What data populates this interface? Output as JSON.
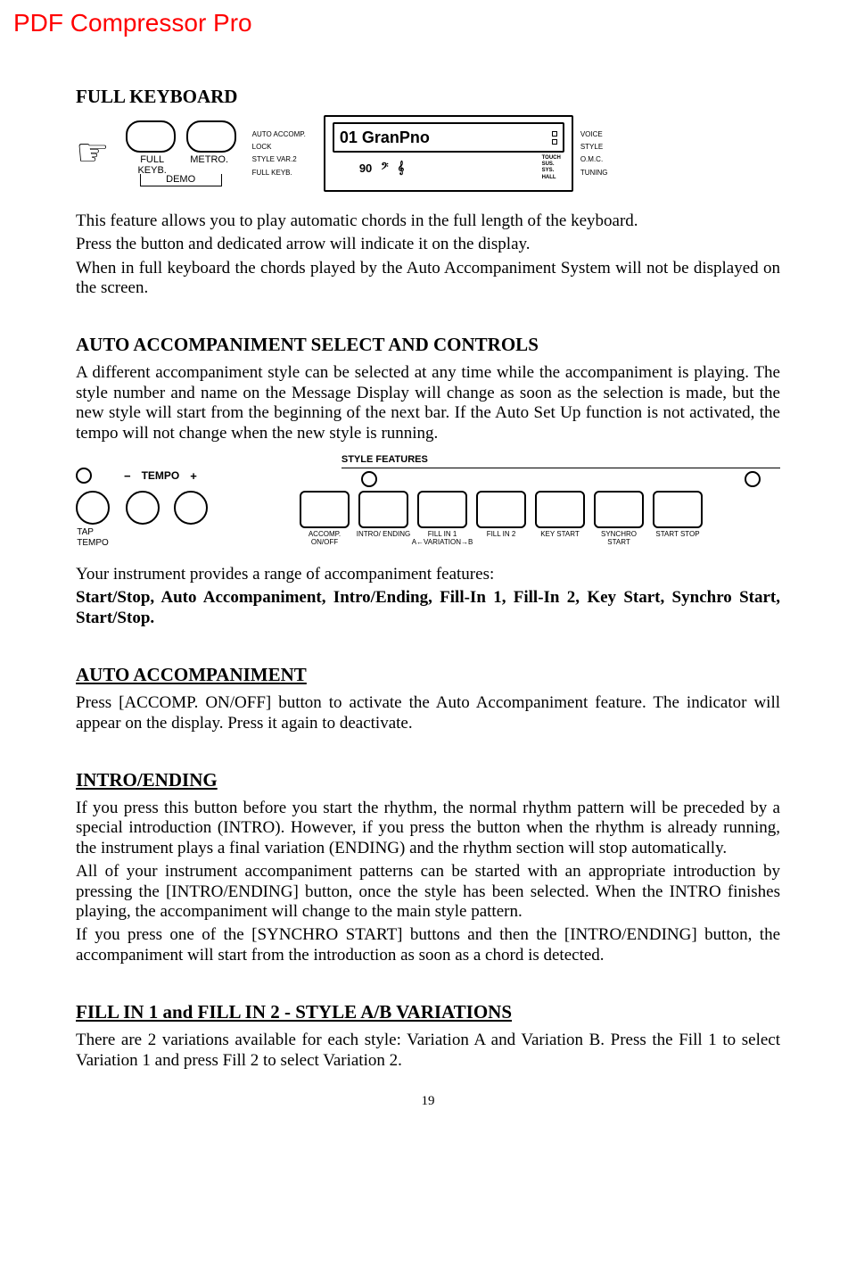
{
  "watermark": "PDF Compressor Pro",
  "page_number": "19",
  "fig1": {
    "btn1": "FULL KEYB.",
    "btn2": "METRO.",
    "demo": "DEMO",
    "left_labels": [
      "AUTO ACCOMP.",
      "LOCK",
      "STYLE VAR.2",
      "FULL KEYB."
    ],
    "lcd_title": "01 GranPno",
    "lcd_tempo": "90",
    "tiny": [
      "TOUCH",
      "SUS.",
      "SYS.",
      "HALL"
    ],
    "right_labels": [
      "VOICE",
      "STYLE",
      "O.M.C.",
      "TUNING"
    ]
  },
  "fig2": {
    "tempo_minus": "−",
    "tempo_hdr": "TEMPO",
    "tempo_plus": "+",
    "sf_hdr": "STYLE FEATURES",
    "tap_label": "TAP\nTEMPO",
    "cols": [
      "ACCOMP. ON/OFF",
      "INTRO/ ENDING",
      "FILL IN 1 A←VARIATION→B",
      "FILL IN 2",
      "KEY START",
      "SYNCHRO START",
      "START STOP"
    ]
  },
  "sections": {
    "s1_title": "FULL KEYBOARD",
    "s1_p1": "This feature allows you to play automatic chords in the full length of the keyboard.",
    "s1_p2": "Press the button and dedicated arrow will indicate it on the display.",
    "s1_p3": "When in full keyboard the chords played by the Auto Accompaniment System will not be displayed on the screen.",
    "s2_title": "AUTO ACCOMPANIMENT SELECT AND CONTROLS",
    "s2_p1": "A different accompaniment style can be selected at any time while the accompaniment is playing. The style number and name on the Message Display will change as soon as the selection is made, but the new style will start from the beginning of the next bar. If the Auto Set Up function is not activated, the tempo will not change when the new style is running.",
    "s2_intro": "Your instrument provides a range of accompaniment features:",
    "s2_bold": "Start/Stop, Auto Accompaniment, Intro/Ending, Fill-In 1, Fill-In 2, Key Start, Synchro Start, Start/Stop.",
    "s3_title": "AUTO ACCOMPANIMENT",
    "s3_p1": "Press [ACCOMP. ON/OFF] button to activate the Auto Accompaniment feature. The indicator will appear on the display. Press it again to deactivate.",
    "s4_title": "INTRO/ENDING",
    "s4_p1": "If you press this button before you start the rhythm, the normal rhythm pattern will be preceded by a special  introduction (INTRO). However, if you press the button when the rhythm is already running, the instrument plays a final variation (ENDING) and the rhythm section will stop automatically.",
    "s4_p2": "All of your instrument accompaniment patterns can be started with an appropriate introduction by pressing the [INTRO/ENDING] button, once the style has been selected. When the INTRO finishes playing, the accompaniment will change  to the main style pattern.",
    "s4_p3": "If you press one of the [SYNCHRO START] buttons and then the [INTRO/ENDING] button, the accompaniment will start from the introduction as soon as a chord is detected.",
    "s5_title": "FILL IN 1 and FILL IN 2  - STYLE A/B VARIATIONS",
    "s5_p1": "There are 2 variations available for each style: Variation A and Variation B.  Press the Fill 1 to select Variation 1 and press Fill 2 to select Variation 2."
  }
}
